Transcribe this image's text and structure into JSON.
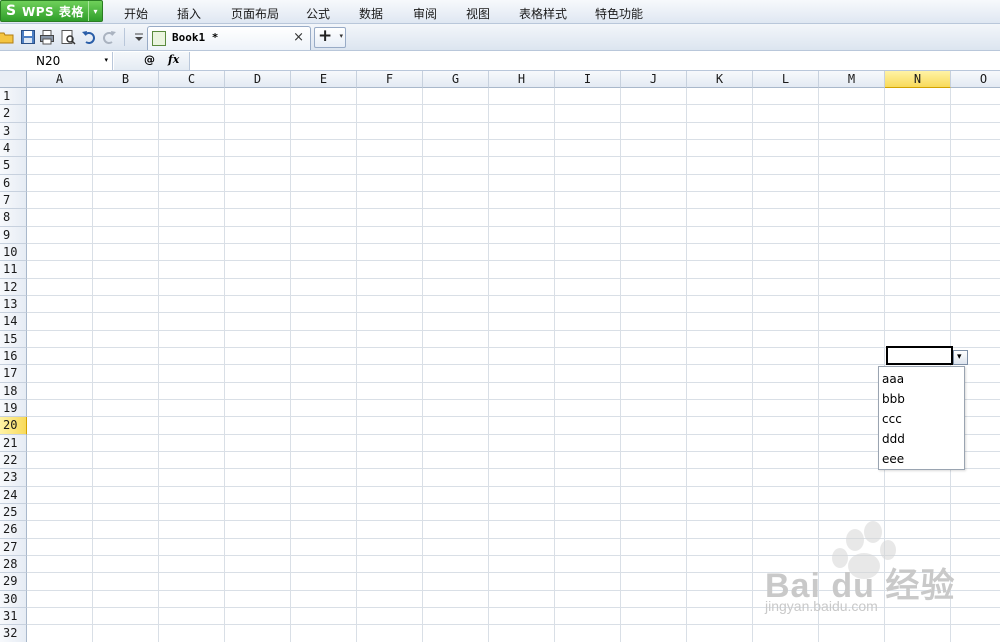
{
  "app": {
    "title": "WPS 表格",
    "logo": "S"
  },
  "menu": [
    "开始",
    "插入",
    "页面布局",
    "公式",
    "数据",
    "审阅",
    "视图",
    "表格样式",
    "特色功能"
  ],
  "toolbar": {
    "icons": [
      "open-folder-icon",
      "save-icon",
      "print-icon",
      "print-preview-icon",
      "undo-icon",
      "redo-icon",
      "customize-dropdown-icon"
    ]
  },
  "document_tab": {
    "title": "Book1 *",
    "close": "×"
  },
  "new_tab": {
    "plus": "+",
    "dropdown": "▾"
  },
  "formula_bar": {
    "name_box": "N20",
    "name_dropdown": "▾",
    "search_glyph": "@",
    "fx_label": "fx",
    "formula_value": ""
  },
  "sheet": {
    "columns": [
      "A",
      "B",
      "C",
      "D",
      "E",
      "F",
      "G",
      "H",
      "I",
      "J",
      "K",
      "L",
      "M",
      "N",
      "O"
    ],
    "rows": [
      "1",
      "2",
      "3",
      "4",
      "5",
      "6",
      "7",
      "8",
      "9",
      "10",
      "11",
      "12",
      "13",
      "14",
      "15",
      "16",
      "17",
      "18",
      "19",
      "20",
      "21",
      "22",
      "23",
      "24",
      "25",
      "26",
      "27",
      "28",
      "29",
      "30",
      "31",
      "32"
    ],
    "active_column": "N",
    "active_row": "20"
  },
  "dropdown": {
    "button": "▾",
    "items": [
      "aaa",
      "bbb",
      "ccc",
      "ddd",
      "eee"
    ]
  },
  "watermark": {
    "brand": "Bai du 经验",
    "url": "jingyan.baidu.com"
  },
  "colors": {
    "wps_green": "#3aa832",
    "active_header": "#f8da5a",
    "grid_line": "#d9dfe6"
  }
}
